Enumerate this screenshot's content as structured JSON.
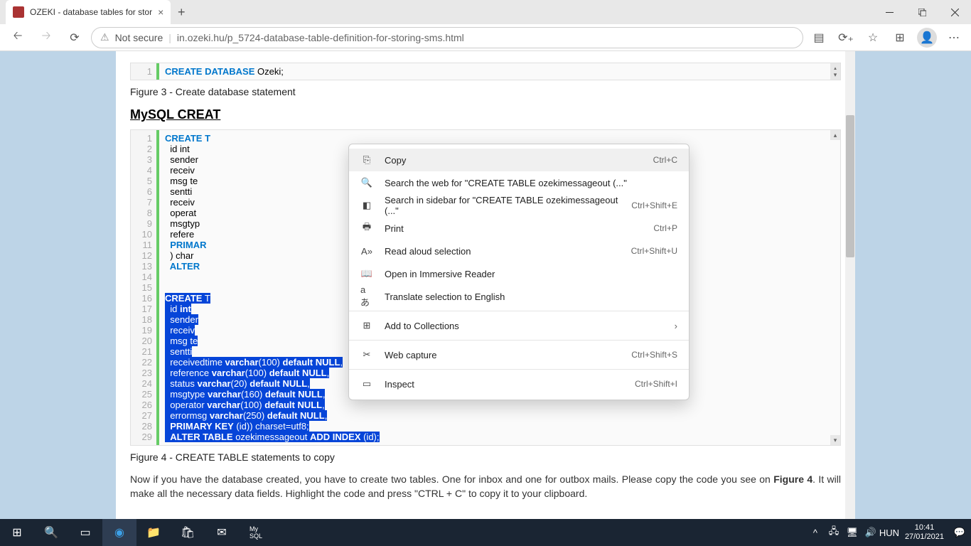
{
  "tab": {
    "title": "OZEKI - database tables for stor"
  },
  "url": {
    "security": "Not secure",
    "domain": "in.ozeki.hu",
    "path": "/p_5724-database-table-definition-for-storing-sms.html"
  },
  "captions": {
    "fig3": "Figure 3 - Create database statement",
    "fig4": "Figure 4 - CREATE TABLE statements to copy"
  },
  "heading": "MySQL CREAT",
  "block1": {
    "lines": [
      "1"
    ],
    "code": "CREATE DATABASE Ozeki;"
  },
  "block2": {
    "lines": [
      "1",
      "2",
      "3",
      "4",
      "5",
      "6",
      "7",
      "8",
      "9",
      "10",
      "11",
      "12",
      "13",
      "14",
      "15",
      "16",
      "17",
      "18",
      "19",
      "20",
      "21",
      "22",
      "23",
      "24",
      "25",
      "26",
      "27",
      "28",
      "29"
    ],
    "visible": [
      "CREATE T",
      "  id int",
      "  sender",
      "  receiv",
      "  msg te",
      "  sentti",
      "  receiv",
      "  operat",
      "  msgtyp",
      "  refere",
      "  PRIMAR",
      "  ) char",
      "  ALTER ",
      "",
      ""
    ],
    "selected": [
      "CREATE T",
      "  id int",
      "  sender",
      "  receiv",
      "  msg te",
      "  sentti",
      "  receivedtime varchar(100) default NULL,",
      "  reference varchar(100) default NULL,",
      "  status varchar(20) default NULL,",
      "  msgtype varchar(160) default NULL,",
      "  operator varchar(100) default NULL,",
      "  errormsg varchar(250) default NULL,",
      "  PRIMARY KEY (id)) charset=utf8;",
      "  ALTER TABLE ozekimessageout ADD INDEX (id);"
    ]
  },
  "paragraph": {
    "p1": "Now if you have the database created, you have to create two tables. One for inbox and one for outbox mails. Please copy the code you see on ",
    "bold": "Figure 4",
    "p2": ". It will make all the necessary data fields. Highlight the code and press \"CTRL + C\" to copy it to your clipboard."
  },
  "context": {
    "copy": {
      "label": "Copy",
      "shortcut": "Ctrl+C"
    },
    "search": {
      "label": "Search the web for \"CREATE TABLE ozekimessageout (...\""
    },
    "sidebar": {
      "label": "Search in sidebar for \"CREATE TABLE ozekimessageout (...\"",
      "shortcut": "Ctrl+Shift+E"
    },
    "print": {
      "label": "Print",
      "shortcut": "Ctrl+P"
    },
    "read": {
      "label": "Read aloud selection",
      "shortcut": "Ctrl+Shift+U"
    },
    "immersive": {
      "label": "Open in Immersive Reader"
    },
    "translate": {
      "label": "Translate selection to English"
    },
    "collections": {
      "label": "Add to Collections"
    },
    "capture": {
      "label": "Web capture",
      "shortcut": "Ctrl+Shift+S"
    },
    "inspect": {
      "label": "Inspect",
      "shortcut": "Ctrl+Shift+I"
    }
  },
  "tray": {
    "lang": "HUN",
    "time": "10:41",
    "date": "27/01/2021"
  }
}
